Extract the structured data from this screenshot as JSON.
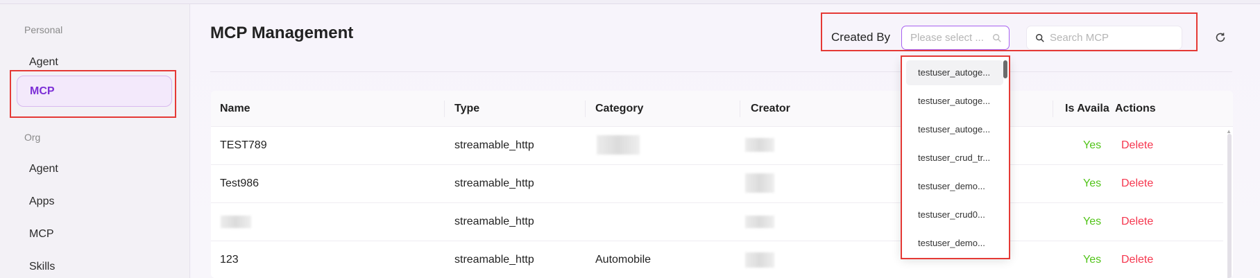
{
  "sidebar": {
    "personal_label": "Personal",
    "personal_items": [
      "Agent",
      "MCP"
    ],
    "org_label": "Org",
    "org_items": [
      "Agent",
      "Apps",
      "MCP",
      "Skills"
    ]
  },
  "header": {
    "title": "MCP Management",
    "created_by_label": "Created By",
    "created_by_placeholder": "Please select ...",
    "search_placeholder": "Search MCP"
  },
  "table": {
    "columns": [
      "Name",
      "Type",
      "Category",
      "Creator",
      "Is Availa",
      "Actions"
    ],
    "rows": [
      {
        "name": "TEST789",
        "type": "streamable_http",
        "category": "",
        "available": "Yes",
        "action": "Delete"
      },
      {
        "name": "Test986",
        "type": "streamable_http",
        "category": "",
        "available": "Yes",
        "action": "Delete"
      },
      {
        "name": "",
        "type": "streamable_http",
        "category": "",
        "available": "Yes",
        "action": "Delete"
      },
      {
        "name": "123",
        "type": "streamable_http",
        "category": "Automobile",
        "available": "Yes",
        "action": "Delete"
      }
    ]
  },
  "dropdown": {
    "options": [
      "testuser_autoge...",
      "testuser_autoge...",
      "testuser_autoge...",
      "testuser_crud_tr...",
      "testuser_demo...",
      "testuser_crud0...",
      "testuser_demo..."
    ]
  },
  "colors": {
    "accent": "#7c2fd6",
    "yes": "#52c41a",
    "delete": "#f5364e",
    "annotation": "#e53935"
  }
}
